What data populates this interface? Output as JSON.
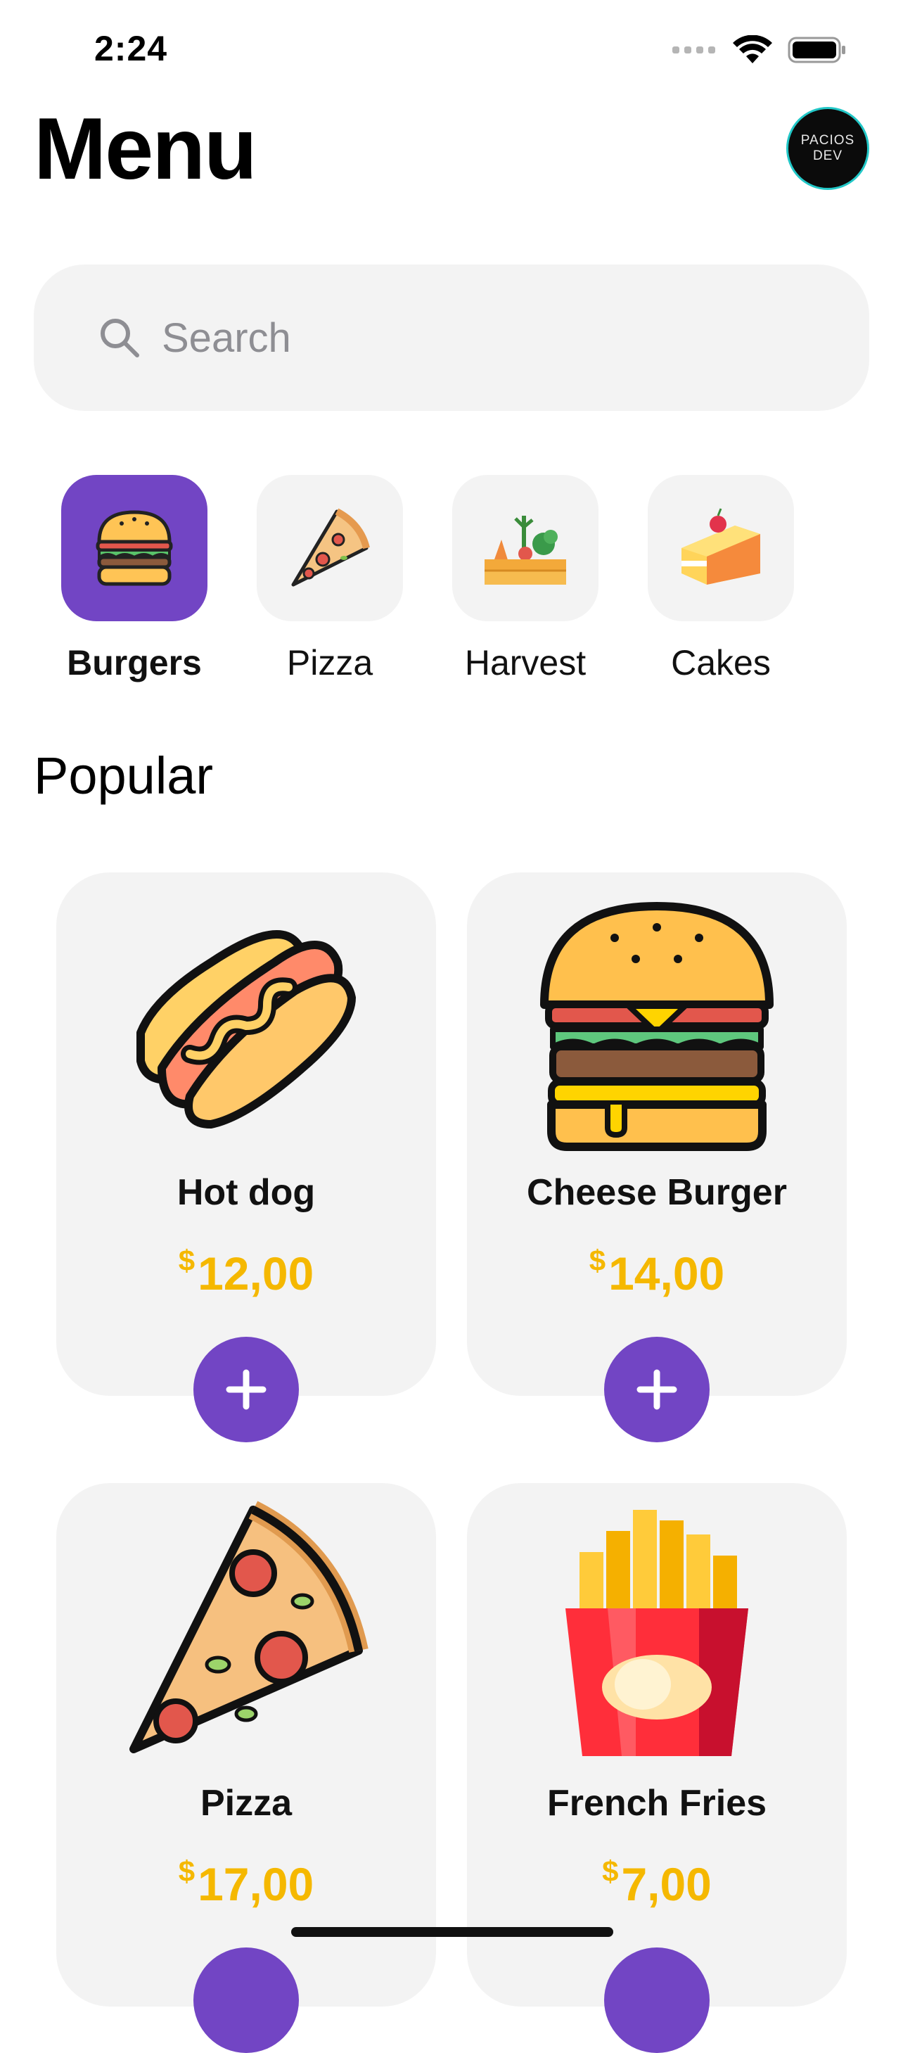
{
  "status": {
    "time": "2:24"
  },
  "header": {
    "title": "Menu",
    "avatar_line1": "PACIOS",
    "avatar_line2": "DEV"
  },
  "search": {
    "placeholder": "Search",
    "value": ""
  },
  "categories": [
    {
      "label": "Burgers",
      "icon": "burger-icon",
      "active": true
    },
    {
      "label": "Pizza",
      "icon": "pizza-slice-icon",
      "active": false
    },
    {
      "label": "Harvest",
      "icon": "vegetable-crate-icon",
      "active": false
    },
    {
      "label": "Cakes",
      "icon": "cake-slice-icon",
      "active": false
    }
  ],
  "popular": {
    "title": "Popular",
    "items": [
      {
        "name": "Hot dog",
        "currency": "$",
        "price": "12,00",
        "icon": "hotdog-icon"
      },
      {
        "name": "Cheese Burger",
        "currency": "$",
        "price": "14,00",
        "icon": "cheeseburger-icon"
      },
      {
        "name": "Pizza",
        "currency": "$",
        "price": "17,00",
        "icon": "pizza-icon"
      },
      {
        "name": "French Fries",
        "currency": "$",
        "price": "7,00",
        "icon": "french-fries-icon"
      }
    ]
  },
  "colors": {
    "accent": "#7245c4",
    "price": "#f5b800",
    "surface": "#f3f3f3"
  }
}
